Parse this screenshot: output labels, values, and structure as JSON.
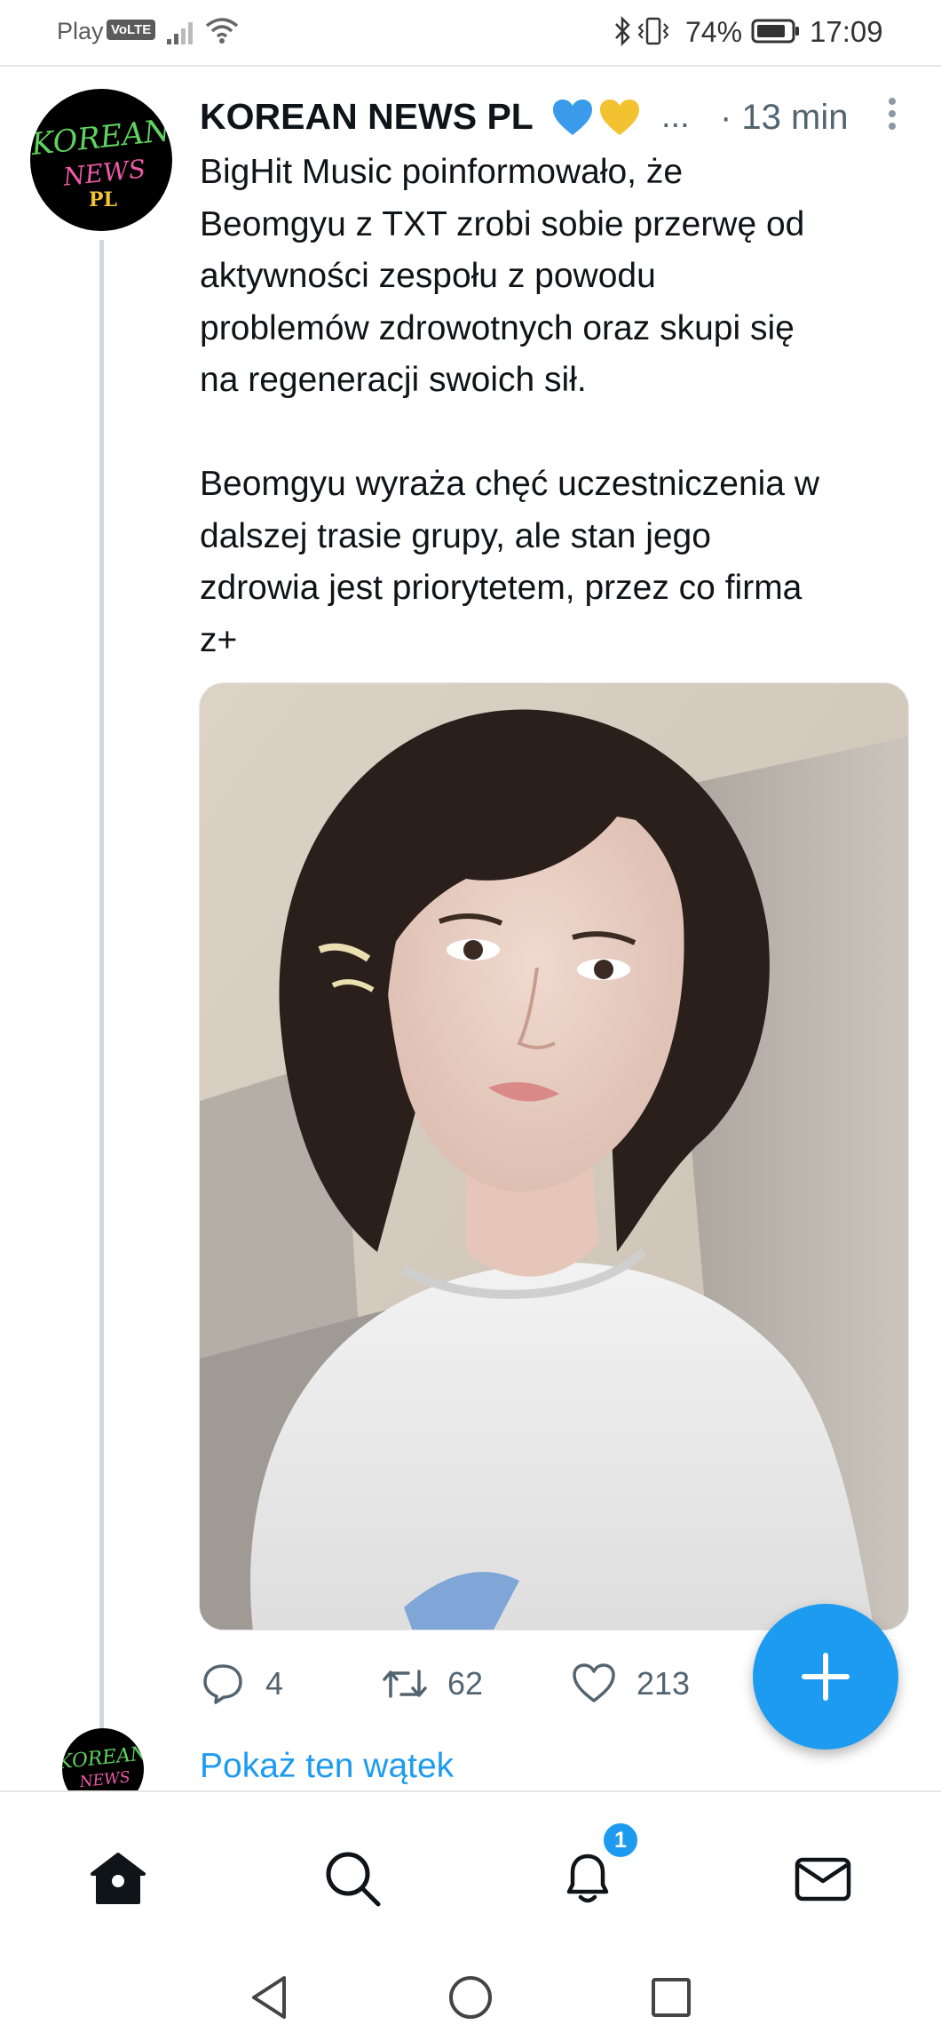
{
  "status_bar": {
    "carrier": "Play",
    "network_badge": "VoLTE",
    "battery_percent": "74%",
    "time": "17:09",
    "icons": [
      "signal-icon",
      "wifi-icon",
      "bluetooth-icon",
      "vibrate-icon",
      "battery-icon"
    ]
  },
  "tweet": {
    "author_name": "KOREAN NEWS PL",
    "author_name_truncation": "...",
    "time": "· 13 min",
    "avatar": {
      "line1": "KOREAN",
      "line2": "NEWS",
      "line3": "PL"
    },
    "paragraphs": [
      "BigHit Music poinformowało, że\nBeomgyu z TXT zrobi sobie przerwę od\naktywności zespołu z powodu\nproblemów zdrowotnych oraz skupi się\nna regeneracji swoich sił.",
      "Beomgyu wyraża chęć uczestniczenia w\ndalszej trasie grupy, ale stan jego\nzdrowia jest priorytetem, przez co firma\nz+"
    ],
    "image_alt": "Selfie of a young man with shoulder-length dark hair in a white t-shirt",
    "stats": {
      "replies": "4",
      "retweets": "62",
      "likes": "213"
    },
    "badge_colors": {
      "blue_heart": "#3a9bea",
      "yellow_heart": "#f2c230"
    }
  },
  "show_thread": "Pokaż ten wątek",
  "bottom_nav": {
    "items": [
      "home-icon",
      "search-icon",
      "notifications-icon",
      "messages-icon"
    ],
    "notification_count": "1"
  },
  "colors": {
    "accent": "#1d9bf0",
    "text": "#0f1419",
    "muted": "#536471"
  }
}
